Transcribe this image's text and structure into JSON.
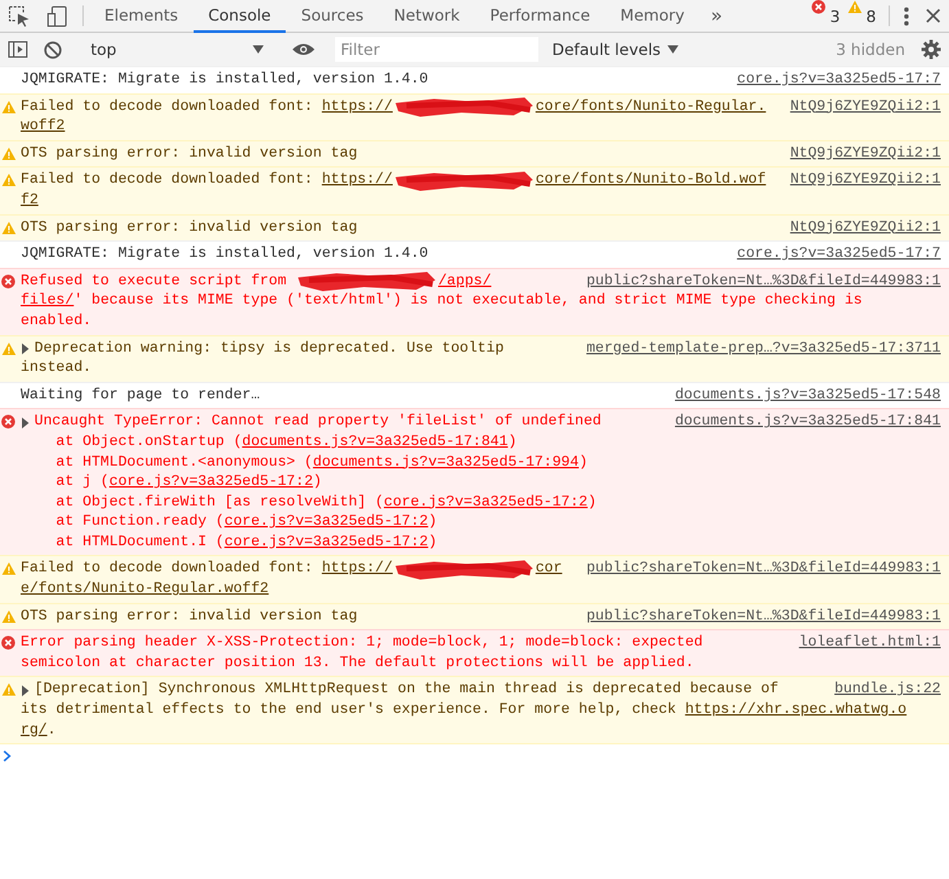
{
  "tabs": [
    {
      "label": "Elements",
      "selected": false
    },
    {
      "label": "Console",
      "selected": true
    },
    {
      "label": "Sources",
      "selected": false
    },
    {
      "label": "Network",
      "selected": false
    },
    {
      "label": "Performance",
      "selected": false
    },
    {
      "label": "Memory",
      "selected": false
    }
  ],
  "overflow": "»",
  "counts": {
    "errors": "3",
    "warnings": "8"
  },
  "console_toolbar": {
    "context": "top",
    "filter": {
      "placeholder": "Filter"
    },
    "levels": "Default levels",
    "hidden": "3 hidden"
  },
  "messages": [
    {
      "kind": "info",
      "lines": [
        [
          {
            "kind": "text",
            "text": "JQMIGRATE: Migrate is installed, version 1.4.0"
          }
        ]
      ],
      "source": "core.js?v=3a325ed5-17:7"
    },
    {
      "kind": "warning",
      "lines": [
        [
          {
            "kind": "text",
            "text": "Failed to decode downloaded font: "
          },
          {
            "kind": "link",
            "text": "https://"
          },
          {
            "kind": "redacted"
          },
          {
            "kind": "link",
            "text": "core/fonts/Nunito-Regular."
          }
        ],
        [
          {
            "kind": "link",
            "text": "woff2"
          }
        ]
      ],
      "source": "NtQ9j6ZYE9ZQii2:1"
    },
    {
      "kind": "warning",
      "lines": [
        [
          {
            "kind": "text",
            "text": "OTS parsing error: invalid version tag"
          }
        ]
      ],
      "source": "NtQ9j6ZYE9ZQii2:1"
    },
    {
      "kind": "warning",
      "lines": [
        [
          {
            "kind": "text",
            "text": "Failed to decode downloaded font: "
          },
          {
            "kind": "link",
            "text": "https://"
          },
          {
            "kind": "redacted"
          },
          {
            "kind": "link",
            "text": "core/fonts/Nunito-Bold.wof"
          }
        ],
        [
          {
            "kind": "link",
            "text": "f2"
          }
        ]
      ],
      "source": "NtQ9j6ZYE9ZQii2:1"
    },
    {
      "kind": "warning",
      "lines": [
        [
          {
            "kind": "text",
            "text": "OTS parsing error: invalid version tag"
          }
        ]
      ],
      "source": "NtQ9j6ZYE9ZQii2:1"
    },
    {
      "kind": "info",
      "lines": [
        [
          {
            "kind": "text",
            "text": "JQMIGRATE: Migrate is installed, version 1.4.0"
          }
        ]
      ],
      "source": "core.js?v=3a325ed5-17:7"
    },
    {
      "kind": "error",
      "lines": [
        [
          {
            "kind": "text",
            "text": "Refused to execute script from "
          },
          {
            "kind": "redacted"
          },
          {
            "kind": "link",
            "text": "/apps/"
          }
        ],
        [
          {
            "kind": "link",
            "text": "files/"
          },
          {
            "kind": "text",
            "text": "' because its MIME type ('text/html') is not executable, and strict MIME type checking is"
          }
        ],
        [
          {
            "kind": "text",
            "text": "enabled."
          }
        ]
      ],
      "source": "public?shareToken=Nt…%3D&fileId=449983:1"
    },
    {
      "kind": "warning",
      "expanded": false,
      "lines": [
        [
          {
            "kind": "text",
            "text": "Deprecation warning: tipsy is deprecated. Use tooltip"
          }
        ],
        [
          {
            "kind": "text",
            "text": "instead."
          }
        ]
      ],
      "source": "merged-template-prep…?v=3a325ed5-17:3711"
    },
    {
      "kind": "info",
      "lines": [
        [
          {
            "kind": "text",
            "text": "Waiting for page to render…"
          }
        ]
      ],
      "source": "documents.js?v=3a325ed5-17:548"
    },
    {
      "kind": "error",
      "expanded": false,
      "lines": [
        [
          {
            "kind": "text",
            "text": "Uncaught TypeError: Cannot read property 'fileList' of undefined"
          }
        ],
        [
          {
            "kind": "text",
            "text": "    at Object.onStartup ("
          },
          {
            "kind": "link",
            "text": "documents.js?v=3a325ed5-17:841"
          },
          {
            "kind": "text",
            "text": ")"
          }
        ],
        [
          {
            "kind": "text",
            "text": "    at HTMLDocument.<anonymous> ("
          },
          {
            "kind": "link",
            "text": "documents.js?v=3a325ed5-17:994"
          },
          {
            "kind": "text",
            "text": ")"
          }
        ],
        [
          {
            "kind": "text",
            "text": "    at j ("
          },
          {
            "kind": "link",
            "text": "core.js?v=3a325ed5-17:2"
          },
          {
            "kind": "text",
            "text": ")"
          }
        ],
        [
          {
            "kind": "text",
            "text": "    at Object.fireWith [as resolveWith] ("
          },
          {
            "kind": "link",
            "text": "core.js?v=3a325ed5-17:2"
          },
          {
            "kind": "text",
            "text": ")"
          }
        ],
        [
          {
            "kind": "text",
            "text": "    at Function.ready ("
          },
          {
            "kind": "link",
            "text": "core.js?v=3a325ed5-17:2"
          },
          {
            "kind": "text",
            "text": ")"
          }
        ],
        [
          {
            "kind": "text",
            "text": "    at HTMLDocument.I ("
          },
          {
            "kind": "link",
            "text": "core.js?v=3a325ed5-17:2"
          },
          {
            "kind": "text",
            "text": ")"
          }
        ]
      ],
      "source": "documents.js?v=3a325ed5-17:841"
    },
    {
      "kind": "warning",
      "lines": [
        [
          {
            "kind": "text",
            "text": "Failed to decode downloaded font: "
          },
          {
            "kind": "link",
            "text": "https://"
          },
          {
            "kind": "redacted"
          },
          {
            "kind": "link",
            "text": "cor"
          }
        ],
        [
          {
            "kind": "link",
            "text": "e/fonts/Nunito-Regular.woff2"
          }
        ]
      ],
      "source": "public?shareToken=Nt…%3D&fileId=449983:1"
    },
    {
      "kind": "warning",
      "lines": [
        [
          {
            "kind": "text",
            "text": "OTS parsing error: invalid version tag"
          }
        ]
      ],
      "source": "public?shareToken=Nt…%3D&fileId=449983:1"
    },
    {
      "kind": "error",
      "lines": [
        [
          {
            "kind": "text",
            "text": "Error parsing header X-XSS-Protection: 1; mode=block, 1; mode=block: expected"
          }
        ],
        [
          {
            "kind": "text",
            "text": "semicolon at character position 13. The default protections will be applied."
          }
        ]
      ],
      "source": "loleaflet.html:1"
    },
    {
      "kind": "warning",
      "expanded": false,
      "lines": [
        [
          {
            "kind": "text",
            "text": "[Deprecation] Synchronous XMLHttpRequest on the main thread is deprecated because of"
          }
        ],
        [
          {
            "kind": "text",
            "text": "its detrimental effects to the end user's experience. For more help, check "
          },
          {
            "kind": "link",
            "text": "https://xhr.spec.whatwg.o"
          }
        ],
        [
          {
            "kind": "link",
            "text": "rg/"
          },
          {
            "kind": "text",
            "text": "."
          }
        ]
      ],
      "source": "bundle.js:22"
    }
  ]
}
